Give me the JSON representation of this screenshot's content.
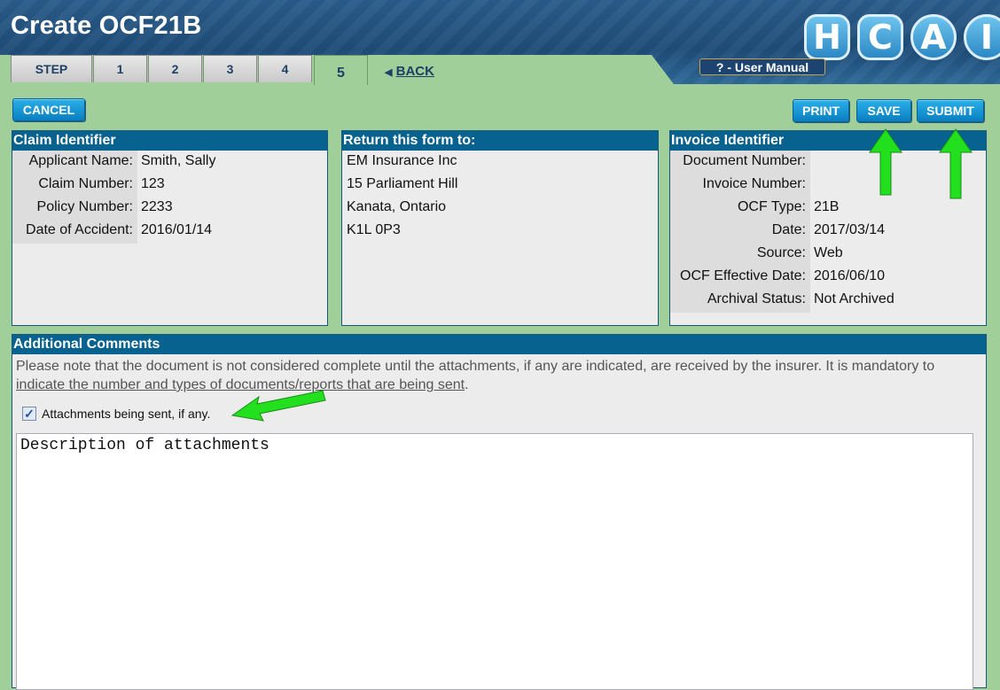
{
  "header": {
    "title": "Create OCF21B",
    "logo_letters": [
      "H",
      "C",
      "A",
      "I"
    ],
    "manual_label": "? - User Manual"
  },
  "tabs": [
    {
      "label": "STEP"
    },
    {
      "label": "1"
    },
    {
      "label": "2"
    },
    {
      "label": "3"
    },
    {
      "label": "4"
    },
    {
      "label": "5",
      "active": true
    }
  ],
  "back_label": "BACK",
  "buttons": {
    "cancel": "CANCEL",
    "print": "PRINT",
    "save": "SAVE",
    "submit": "SUBMIT"
  },
  "claim": {
    "heading": "Claim Identifier",
    "rows": [
      {
        "label": "Applicant Name:",
        "value": "Smith, Sally"
      },
      {
        "label": "Claim Number:",
        "value": "123"
      },
      {
        "label": "Policy Number:",
        "value": "2233"
      },
      {
        "label": "Date of Accident:",
        "value": "2016/01/14"
      }
    ]
  },
  "return_to": {
    "heading": "Return this form to:",
    "lines": [
      "EM Insurance Inc",
      "15 Parliament Hill",
      "Kanata, Ontario",
      "K1L 0P3"
    ]
  },
  "invoice": {
    "heading": "Invoice Identifier",
    "rows": [
      {
        "label": "Document Number:",
        "value": ""
      },
      {
        "label": "Invoice Number:",
        "value": ""
      },
      {
        "label": "OCF Type:",
        "value": "21B"
      },
      {
        "label": "Date:",
        "value": "2017/03/14"
      },
      {
        "label": "Source:",
        "value": "Web"
      },
      {
        "label": "OCF Effective Date:",
        "value": "2016/06/10"
      },
      {
        "label": "Archival Status:",
        "value": "Not Archived"
      }
    ]
  },
  "comments": {
    "heading": "Additional Comments",
    "note_plain": "Please note that the document is not considered complete until the attachments, if any are indicated, are received by the insurer. It is mandatory to ",
    "note_underlined": "indicate the number and types of documents/reports that are being sent",
    "note_end": ".",
    "checkbox_label": "Attachments being sent, if any.",
    "checkbox_checked": true,
    "textarea_value": "Description of attachments"
  },
  "colors": {
    "background": "#a0cf9a",
    "panel_header": "#07628f",
    "button": "#0a8fd0",
    "arrow": "#22e01e"
  }
}
